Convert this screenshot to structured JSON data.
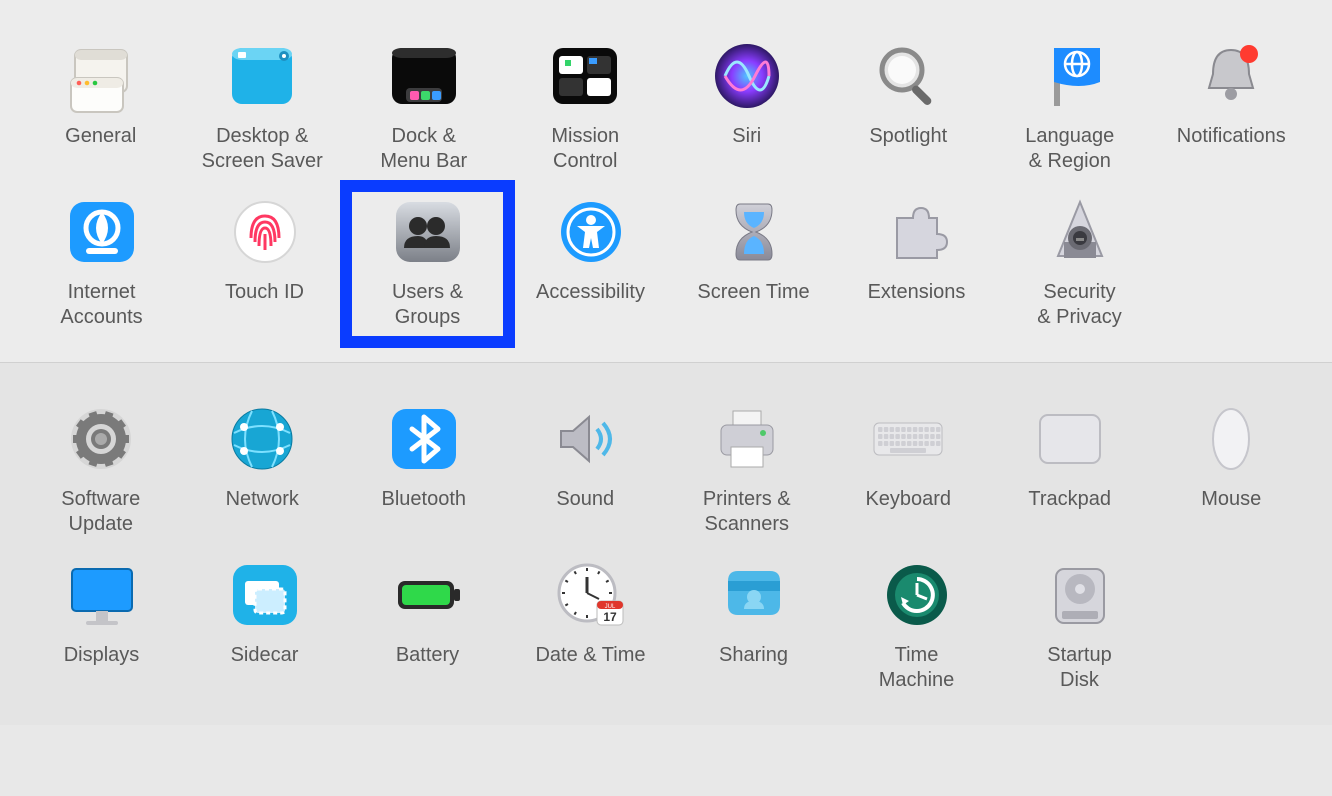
{
  "sections": [
    {
      "id": "top",
      "rows": [
        [
          {
            "id": "general",
            "label": "General",
            "icon": "general"
          },
          {
            "id": "desktop",
            "label": "Desktop &\nScreen Saver",
            "icon": "desktop"
          },
          {
            "id": "dock",
            "label": "Dock &\nMenu Bar",
            "icon": "dock"
          },
          {
            "id": "mission",
            "label": "Mission\nControl",
            "icon": "mission"
          },
          {
            "id": "siri",
            "label": "Siri",
            "icon": "siri"
          },
          {
            "id": "spotlight",
            "label": "Spotlight",
            "icon": "spotlight"
          },
          {
            "id": "language",
            "label": "Language\n& Region",
            "icon": "language"
          },
          {
            "id": "notifications",
            "label": "Notifications",
            "icon": "notifications"
          }
        ],
        [
          {
            "id": "internet",
            "label": "Internet\nAccounts",
            "icon": "internet"
          },
          {
            "id": "touchid",
            "label": "Touch ID",
            "icon": "touchid"
          },
          {
            "id": "users",
            "label": "Users &\nGroups",
            "icon": "users",
            "highlighted": true
          },
          {
            "id": "accessibility",
            "label": "Accessibility",
            "icon": "accessibility"
          },
          {
            "id": "screentime",
            "label": "Screen Time",
            "icon": "screentime"
          },
          {
            "id": "extensions",
            "label": "Extensions",
            "icon": "extensions"
          },
          {
            "id": "security",
            "label": "Security\n& Privacy",
            "icon": "security"
          }
        ]
      ]
    },
    {
      "id": "bottom",
      "rows": [
        [
          {
            "id": "software",
            "label": "Software\nUpdate",
            "icon": "software"
          },
          {
            "id": "network",
            "label": "Network",
            "icon": "network"
          },
          {
            "id": "bluetooth",
            "label": "Bluetooth",
            "icon": "bluetooth"
          },
          {
            "id": "sound",
            "label": "Sound",
            "icon": "sound"
          },
          {
            "id": "printers",
            "label": "Printers &\nScanners",
            "icon": "printers"
          },
          {
            "id": "keyboard",
            "label": "Keyboard",
            "icon": "keyboard"
          },
          {
            "id": "trackpad",
            "label": "Trackpad",
            "icon": "trackpad"
          },
          {
            "id": "mouse",
            "label": "Mouse",
            "icon": "mouse"
          }
        ],
        [
          {
            "id": "displays",
            "label": "Displays",
            "icon": "displays"
          },
          {
            "id": "sidecar",
            "label": "Sidecar",
            "icon": "sidecar"
          },
          {
            "id": "battery",
            "label": "Battery",
            "icon": "battery"
          },
          {
            "id": "datetime",
            "label": "Date & Time",
            "icon": "datetime"
          },
          {
            "id": "sharing",
            "label": "Sharing",
            "icon": "sharing"
          },
          {
            "id": "timemachine",
            "label": "Time\nMachine",
            "icon": "timemachine"
          },
          {
            "id": "startup",
            "label": "Startup\nDisk",
            "icon": "startup"
          }
        ]
      ]
    }
  ]
}
